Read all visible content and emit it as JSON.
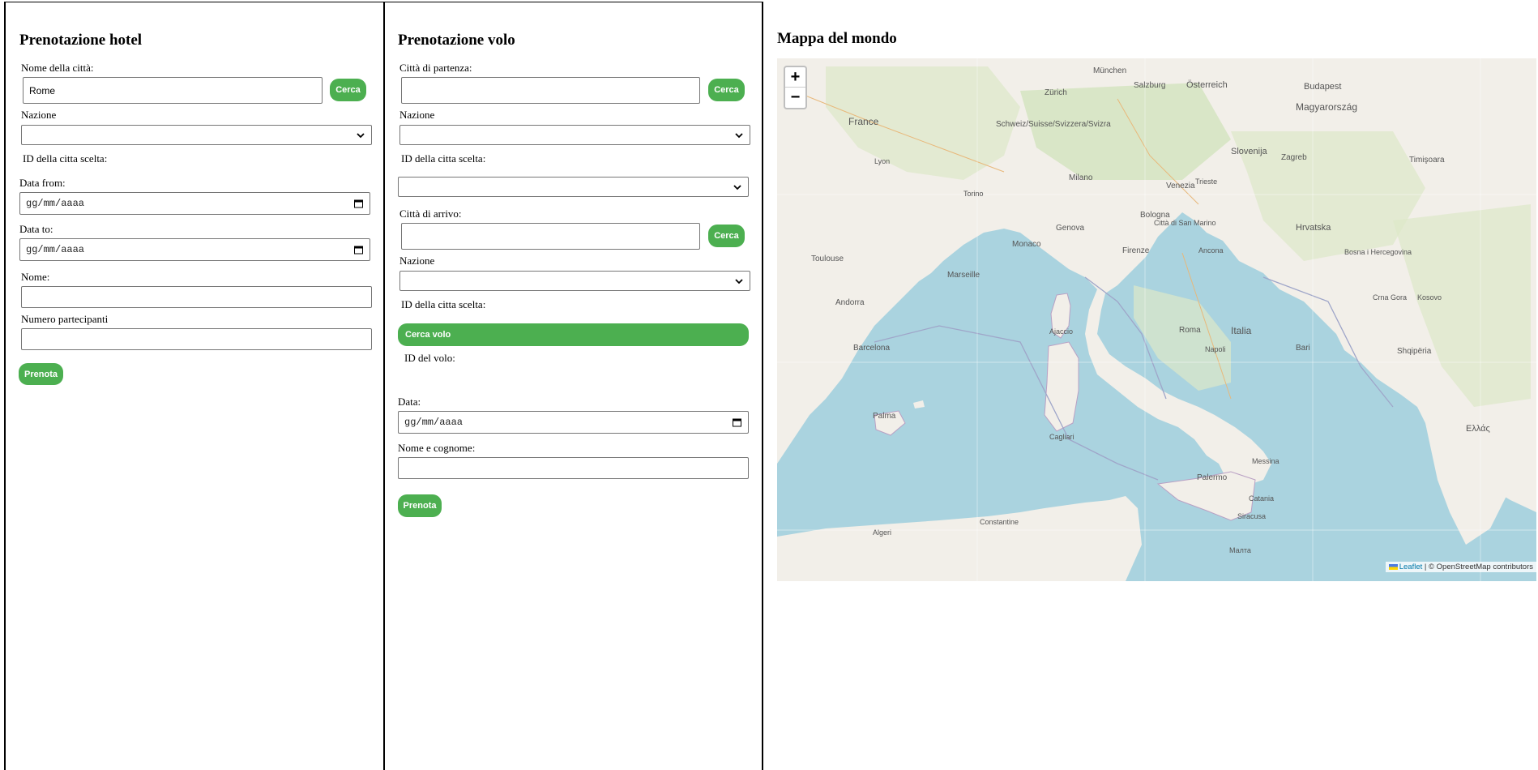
{
  "hotel": {
    "title": "Prenotazione hotel",
    "city_label": "Nome della città:",
    "city_value": "Rome",
    "search_button": "Cerca",
    "nation_label": "Nazione",
    "nation_selected": "",
    "city_id_label": "ID della citta scelta:",
    "date_from_label": "Data from:",
    "date_from_value": "gg/mm/aaaa",
    "date_to_label": "Data to:",
    "date_to_value": "gg/mm/aaaa",
    "name_label": "Nome:",
    "name_value": "",
    "participants_label": "Numero partecipanti",
    "participants_value": "",
    "book_button": "Prenota"
  },
  "flight": {
    "title": "Prenotazione volo",
    "departure_label": "Città di partenza:",
    "departure_value": "",
    "search_button_1": "Cerca",
    "nation_label_1": "Nazione",
    "nation_selected_1": "",
    "city_id_label_1": "ID della citta scelta:",
    "city_id_selected_1": "",
    "arrival_label": "Città di arrivo:",
    "arrival_value": "",
    "search_button_2": "Cerca",
    "nation_label_2": "Nazione",
    "nation_selected_2": "",
    "city_id_label_2": "ID della citta scelta:",
    "search_flight_button": "Cerca volo",
    "flight_id_label": "ID del volo:",
    "date_label": "Data:",
    "date_value": "gg/mm/aaaa",
    "fullname_label": "Nome e cognome:",
    "fullname_value": "",
    "book_button": "Prenota"
  },
  "map": {
    "title": "Mappa del mondo",
    "zoom_in": "+",
    "zoom_out": "−",
    "attribution_leaflet": "Leaflet",
    "attribution_rest": " | © OpenStreetMap contributors",
    "places": [
      "München",
      "Zürich",
      "Salzburg",
      "Österreich",
      "Budapest",
      "Magyarország",
      "France",
      "Schweiz/Suisse/Svizzera/Svizra",
      "Slovenija",
      "Zagreb",
      "Hrvatska",
      "Timişoara",
      "Toulouse",
      "Marseille",
      "Monaco",
      "Genova",
      "Venezia",
      "Bologna",
      "Firenze",
      "Città di San Marino",
      "Ancona",
      "Roma",
      "Italia",
      "Napoli",
      "Bari",
      "Palermo",
      "Messina",
      "Catania",
      "Siracusa",
      "Cagliari",
      "Ajaccio",
      "Barcelona",
      "Andorra",
      "Palma",
      "Algeri",
      "Constantine",
      "Bosna i Hercegovina",
      "Crna Gora",
      "Kosovo",
      "Shqipëria",
      "Ελλάς",
      "Малта",
      "Milano",
      "Torino",
      "Trieste",
      "Lyon"
    ]
  },
  "colors": {
    "accent": "#4caf50",
    "sea": "#aad3df",
    "land": "#f2efe9",
    "green": "#cfe3b8"
  }
}
